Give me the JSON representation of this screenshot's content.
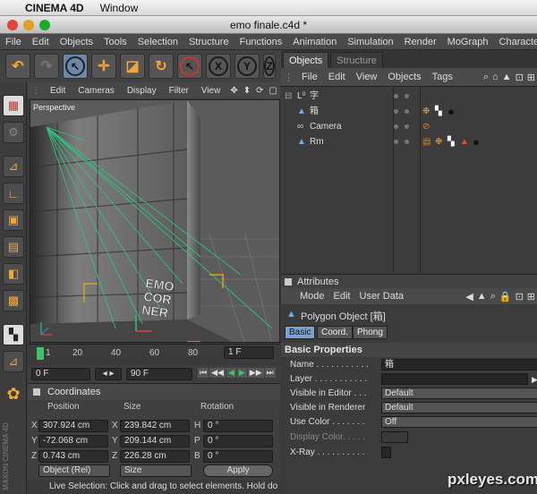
{
  "mac_menubar": {
    "app_name": "CINEMA 4D",
    "window_menu": "Window"
  },
  "window": {
    "title": "emo finale.c4d *"
  },
  "app_menu": [
    "File",
    "Edit",
    "Objects",
    "Tools",
    "Selection",
    "Structure",
    "Functions",
    "Animation",
    "Simulation",
    "Render",
    "MoGraph",
    "Character"
  ],
  "toolbar": {
    "axis_x": "X",
    "axis_y": "Y",
    "axis_z": "Z"
  },
  "viewport": {
    "menu": [
      "Edit",
      "Cameras",
      "Display",
      "Filter",
      "View"
    ],
    "label": "Perspective",
    "sign_lines": [
      "EMO",
      "COR",
      "NER"
    ]
  },
  "timeline": {
    "ticks": [
      "1",
      "20",
      "40",
      "60",
      "80"
    ],
    "current_frame": "1 F"
  },
  "frames": {
    "start": "0 F",
    "end": "90 F"
  },
  "coordinates": {
    "title": "Coordinates",
    "headers": {
      "position": "Position",
      "size": "Size",
      "rotation": "Rotation"
    },
    "rows": [
      {
        "axis": "X",
        "position": "307.924 cm",
        "size_axis": "X",
        "size": "239.842 cm",
        "rot_axis": "H",
        "rotation": "0 °"
      },
      {
        "axis": "Y",
        "position": "-72.068 cm",
        "size_axis": "Y",
        "size": "209.144 cm",
        "rot_axis": "P",
        "rotation": "0 °"
      },
      {
        "axis": "Z",
        "position": "0.743 cm",
        "size_axis": "Z",
        "size": "226.28 cm",
        "rot_axis": "B",
        "rotation": "0 °"
      }
    ],
    "mode": "Object (Rel)",
    "size_mode": "Size",
    "apply_label": "Apply"
  },
  "status": "Live Selection: Click and drag to select elements. Hold do",
  "right_tabs": [
    "Objects",
    "Structure"
  ],
  "objects_menu": [
    "File",
    "Edit",
    "View",
    "Objects",
    "Tags"
  ],
  "objects": [
    {
      "name": "字",
      "icon": "null-object-icon"
    },
    {
      "name": "箱",
      "icon": "polygon-object-icon"
    },
    {
      "name": "Camera",
      "icon": "camera-icon"
    },
    {
      "name": "Rm",
      "icon": "polygon-object-icon"
    }
  ],
  "attributes": {
    "title": "Attributes",
    "menu": [
      "Mode",
      "Edit",
      "User Data"
    ],
    "object_title": "Polygon Object [箱]",
    "tabs": [
      "Basic",
      "Coord.",
      "Phong"
    ],
    "section": "Basic Properties",
    "props": [
      {
        "label": "Name . . . . . . . . . . .",
        "value": "箱"
      },
      {
        "label": "Layer . . . . . . . . . . .",
        "value": ""
      },
      {
        "label": "Visible in Editor . . .",
        "value": "Default"
      },
      {
        "label": "Visible in Renderer",
        "value": "Default"
      },
      {
        "label": "Use Color . . . . . . .",
        "value": "Off"
      },
      {
        "label": "Display Color. . . . .",
        "value": ""
      },
      {
        "label": "X-Ray . . . . . . . . . .",
        "value": ""
      }
    ]
  },
  "watermark": "pxleyes.com"
}
